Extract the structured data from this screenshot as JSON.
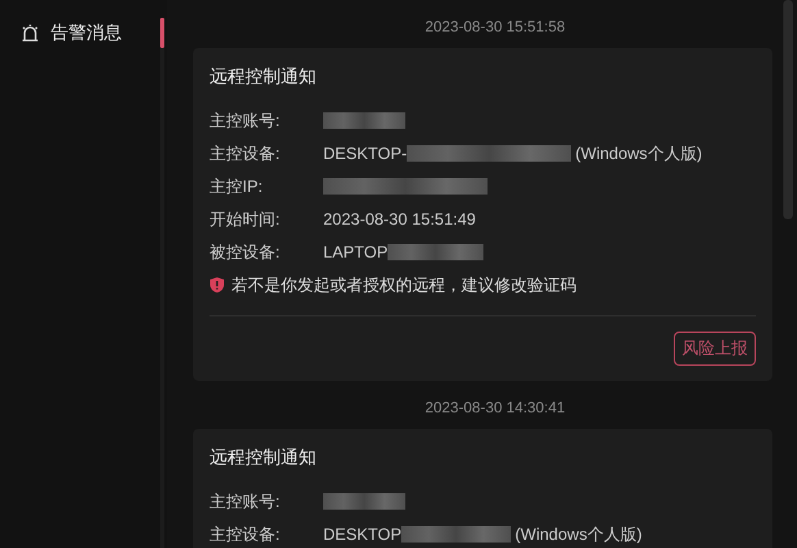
{
  "sidebar": {
    "items": [
      {
        "label": "告警消息",
        "selected": true
      }
    ]
  },
  "messages": [
    {
      "time": "2023-08-30 15:51:58",
      "title": "远程控制通知",
      "fields": [
        {
          "label": "主控账号:",
          "redacted": true
        },
        {
          "label": "主控设备:",
          "value": "DESKTOP-",
          "redacted": true,
          "suffix": "(Windows个人版)"
        },
        {
          "label": "主控IP:",
          "redacted": true
        },
        {
          "label": "开始时间:",
          "value": "2023-08-30 15:51:49",
          "redacted": false
        },
        {
          "label": "被控设备:",
          "value": "LAPTOP",
          "redacted": true
        }
      ],
      "warning": "若不是你发起或者授权的远程，建议修改验证码",
      "action": "风险上报"
    },
    {
      "time": "2023-08-30 14:30:41",
      "title": "远程控制通知",
      "fields": [
        {
          "label": "主控账号:",
          "redacted": true
        },
        {
          "label": "主控设备:",
          "value": "DESKTOP",
          "redacted": true,
          "suffix": "(Windows个人版)"
        }
      ]
    }
  ]
}
